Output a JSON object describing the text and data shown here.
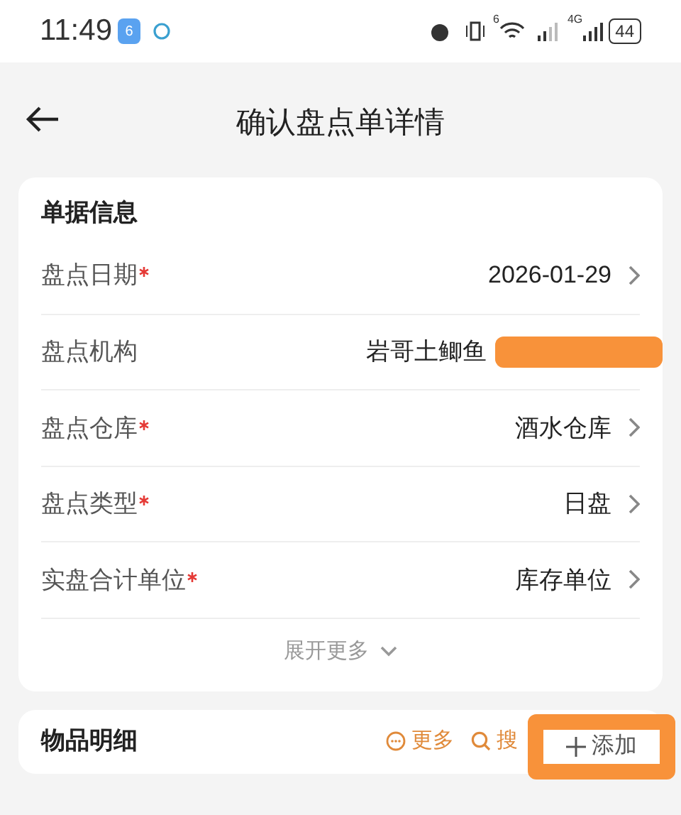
{
  "status_bar": {
    "time": "11:49",
    "app_badge": "6",
    "wifi_badge": "6",
    "network": "4G",
    "battery": "44"
  },
  "header": {
    "title": "确认盘点单详情"
  },
  "info_card": {
    "title": "单据信息",
    "rows": [
      {
        "label": "盘点日期",
        "required": true,
        "value": "2026-01-29",
        "chevron": true,
        "redacted": false
      },
      {
        "label": "盘点机构",
        "required": false,
        "value": "岩哥土鲫鱼",
        "chevron": false,
        "redacted": true
      },
      {
        "label": "盘点仓库",
        "required": true,
        "value": "酒水仓库",
        "chevron": true,
        "redacted": false
      },
      {
        "label": "盘点类型",
        "required": true,
        "value": "日盘",
        "chevron": true,
        "redacted": false
      },
      {
        "label": "实盘合计单位",
        "required": true,
        "value": "库存单位",
        "chevron": true,
        "redacted": false
      }
    ],
    "expand": "展开更多"
  },
  "items_card": {
    "title": "物品明细",
    "actions": [
      {
        "kind": "more",
        "label": "更多"
      },
      {
        "kind": "search",
        "label": "搜"
      },
      {
        "kind": "add",
        "label": "添加"
      }
    ]
  }
}
